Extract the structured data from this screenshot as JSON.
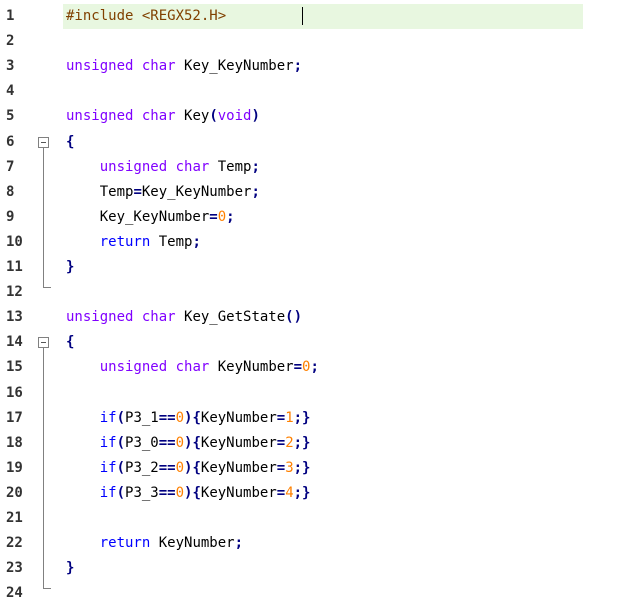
{
  "editor": {
    "language": "C",
    "current_line": 1,
    "lines": [
      {
        "num": "1",
        "fold": "none",
        "tokens": [
          {
            "t": "pre",
            "v": "#include <REGX52.H>"
          }
        ]
      },
      {
        "num": "2",
        "fold": "none",
        "tokens": []
      },
      {
        "num": "3",
        "fold": "none",
        "tokens": [
          {
            "t": "type",
            "v": "unsigned"
          },
          {
            "t": "id",
            "v": " "
          },
          {
            "t": "type",
            "v": "char"
          },
          {
            "t": "id",
            "v": " Key_KeyNumber"
          },
          {
            "t": "op",
            "v": ";"
          }
        ]
      },
      {
        "num": "4",
        "fold": "none",
        "tokens": []
      },
      {
        "num": "5",
        "fold": "none",
        "tokens": [
          {
            "t": "type",
            "v": "unsigned"
          },
          {
            "t": "id",
            "v": " "
          },
          {
            "t": "type",
            "v": "char"
          },
          {
            "t": "id",
            "v": " Key"
          },
          {
            "t": "op",
            "v": "("
          },
          {
            "t": "type",
            "v": "void"
          },
          {
            "t": "op",
            "v": ")"
          }
        ]
      },
      {
        "num": "6",
        "fold": "open",
        "tokens": [
          {
            "t": "op",
            "v": "{"
          }
        ]
      },
      {
        "num": "7",
        "fold": "body",
        "tokens": [
          {
            "t": "id",
            "v": "    "
          },
          {
            "t": "type",
            "v": "unsigned"
          },
          {
            "t": "id",
            "v": " "
          },
          {
            "t": "type",
            "v": "char"
          },
          {
            "t": "id",
            "v": " Temp"
          },
          {
            "t": "op",
            "v": ";"
          }
        ]
      },
      {
        "num": "8",
        "fold": "body",
        "tokens": [
          {
            "t": "id",
            "v": "    Temp"
          },
          {
            "t": "op",
            "v": "="
          },
          {
            "t": "id",
            "v": "Key_KeyNumber"
          },
          {
            "t": "op",
            "v": ";"
          }
        ]
      },
      {
        "num": "9",
        "fold": "body",
        "tokens": [
          {
            "t": "id",
            "v": "    Key_KeyNumber"
          },
          {
            "t": "op",
            "v": "="
          },
          {
            "t": "num",
            "v": "0"
          },
          {
            "t": "op",
            "v": ";"
          }
        ]
      },
      {
        "num": "10",
        "fold": "body",
        "tokens": [
          {
            "t": "id",
            "v": "    "
          },
          {
            "t": "kw",
            "v": "return"
          },
          {
            "t": "id",
            "v": " Temp"
          },
          {
            "t": "op",
            "v": ";"
          }
        ]
      },
      {
        "num": "11",
        "fold": "body",
        "tokens": [
          {
            "t": "op",
            "v": "}"
          }
        ]
      },
      {
        "num": "12",
        "fold": "close",
        "tokens": []
      },
      {
        "num": "13",
        "fold": "none",
        "tokens": [
          {
            "t": "type",
            "v": "unsigned"
          },
          {
            "t": "id",
            "v": " "
          },
          {
            "t": "type",
            "v": "char"
          },
          {
            "t": "id",
            "v": " Key_GetState"
          },
          {
            "t": "op",
            "v": "()"
          }
        ]
      },
      {
        "num": "14",
        "fold": "open",
        "tokens": [
          {
            "t": "op",
            "v": "{"
          }
        ]
      },
      {
        "num": "15",
        "fold": "body",
        "tokens": [
          {
            "t": "id",
            "v": "    "
          },
          {
            "t": "type",
            "v": "unsigned"
          },
          {
            "t": "id",
            "v": " "
          },
          {
            "t": "type",
            "v": "char"
          },
          {
            "t": "id",
            "v": " KeyNumber"
          },
          {
            "t": "op",
            "v": "="
          },
          {
            "t": "num",
            "v": "0"
          },
          {
            "t": "op",
            "v": ";"
          }
        ]
      },
      {
        "num": "16",
        "fold": "body",
        "tokens": []
      },
      {
        "num": "17",
        "fold": "body",
        "tokens": [
          {
            "t": "id",
            "v": "    "
          },
          {
            "t": "kw",
            "v": "if"
          },
          {
            "t": "op",
            "v": "("
          },
          {
            "t": "id",
            "v": "P3_1"
          },
          {
            "t": "op",
            "v": "=="
          },
          {
            "t": "num",
            "v": "0"
          },
          {
            "t": "op",
            "v": "){"
          },
          {
            "t": "id",
            "v": "KeyNumber"
          },
          {
            "t": "op",
            "v": "="
          },
          {
            "t": "num",
            "v": "1"
          },
          {
            "t": "op",
            "v": ";}"
          }
        ]
      },
      {
        "num": "18",
        "fold": "body",
        "tokens": [
          {
            "t": "id",
            "v": "    "
          },
          {
            "t": "kw",
            "v": "if"
          },
          {
            "t": "op",
            "v": "("
          },
          {
            "t": "id",
            "v": "P3_0"
          },
          {
            "t": "op",
            "v": "=="
          },
          {
            "t": "num",
            "v": "0"
          },
          {
            "t": "op",
            "v": "){"
          },
          {
            "t": "id",
            "v": "KeyNumber"
          },
          {
            "t": "op",
            "v": "="
          },
          {
            "t": "num",
            "v": "2"
          },
          {
            "t": "op",
            "v": ";}"
          }
        ]
      },
      {
        "num": "19",
        "fold": "body",
        "tokens": [
          {
            "t": "id",
            "v": "    "
          },
          {
            "t": "kw",
            "v": "if"
          },
          {
            "t": "op",
            "v": "("
          },
          {
            "t": "id",
            "v": "P3_2"
          },
          {
            "t": "op",
            "v": "=="
          },
          {
            "t": "num",
            "v": "0"
          },
          {
            "t": "op",
            "v": "){"
          },
          {
            "t": "id",
            "v": "KeyNumber"
          },
          {
            "t": "op",
            "v": "="
          },
          {
            "t": "num",
            "v": "3"
          },
          {
            "t": "op",
            "v": ";}"
          }
        ]
      },
      {
        "num": "20",
        "fold": "body",
        "tokens": [
          {
            "t": "id",
            "v": "    "
          },
          {
            "t": "kw",
            "v": "if"
          },
          {
            "t": "op",
            "v": "("
          },
          {
            "t": "id",
            "v": "P3_3"
          },
          {
            "t": "op",
            "v": "=="
          },
          {
            "t": "num",
            "v": "0"
          },
          {
            "t": "op",
            "v": "){"
          },
          {
            "t": "id",
            "v": "KeyNumber"
          },
          {
            "t": "op",
            "v": "="
          },
          {
            "t": "num",
            "v": "4"
          },
          {
            "t": "op",
            "v": ";}"
          }
        ]
      },
      {
        "num": "21",
        "fold": "body",
        "tokens": []
      },
      {
        "num": "22",
        "fold": "body",
        "tokens": [
          {
            "t": "id",
            "v": "    "
          },
          {
            "t": "kw",
            "v": "return"
          },
          {
            "t": "id",
            "v": " KeyNumber"
          },
          {
            "t": "op",
            "v": ";"
          }
        ]
      },
      {
        "num": "23",
        "fold": "body",
        "tokens": [
          {
            "t": "op",
            "v": "}"
          }
        ]
      },
      {
        "num": "24",
        "fold": "close",
        "tokens": []
      }
    ]
  },
  "colors": {
    "current_line_bg": "#e8f7e0",
    "preprocessor": "#804000",
    "keyword": "#0000ff",
    "type": "#8000ff",
    "number": "#ff8000",
    "operator": "#000080",
    "identifier": "#000000"
  }
}
